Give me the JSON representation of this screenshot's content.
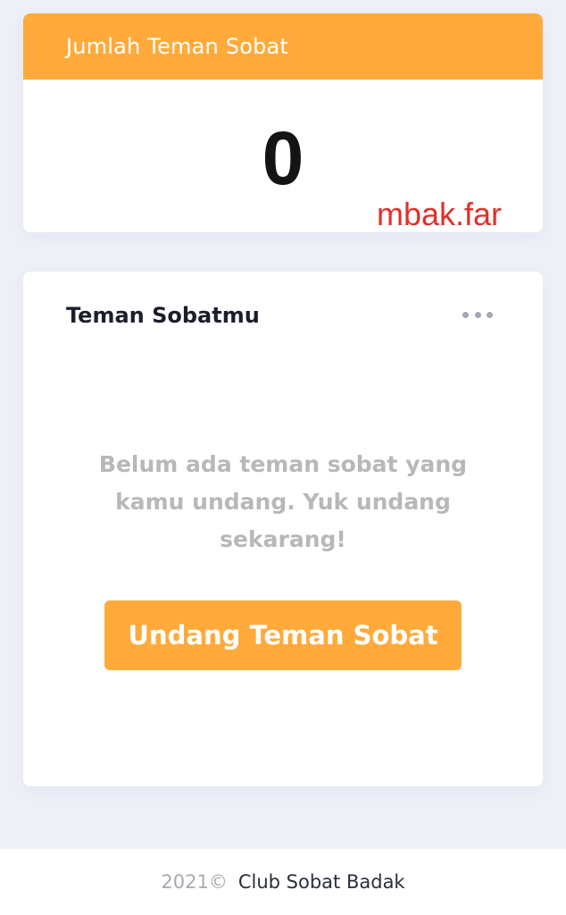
{
  "count_card": {
    "header_title": "Jumlah Teman Sobat",
    "count": "0",
    "watermark": "mbak.far"
  },
  "friends_card": {
    "title": "Teman Sobatmu",
    "more_icon": "ellipsis-icon",
    "empty_message": "Belum ada teman sobat yang kamu undang. Yuk undang sekarang!",
    "invite_button_label": "Undang Teman Sobat"
  },
  "footer": {
    "year": "2021©",
    "brand": "Club Sobat Badak"
  },
  "colors": {
    "accent": "#ffaa3b",
    "background": "#eef0f8",
    "watermark": "#e0302a"
  }
}
